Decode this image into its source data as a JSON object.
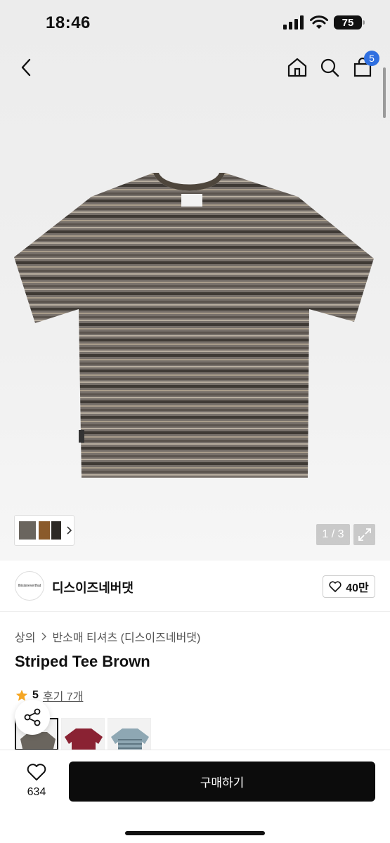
{
  "status_bar": {
    "time": "18:46",
    "battery": "75"
  },
  "nav": {
    "cart_count": "5"
  },
  "gallery": {
    "counter": "1 / 3"
  },
  "brand": {
    "name": "디스이즈네버댓",
    "logo_text": "thisisneverthat",
    "likes": "40만"
  },
  "breadcrumb": {
    "category": "상의",
    "subcategory": "반소매 티셔츠 (디스이즈네버댓)"
  },
  "product": {
    "title": "Striped Tee Brown"
  },
  "rating": {
    "score": "5",
    "reviews": "후기 7개"
  },
  "swatches": [
    {
      "color": "#6a655e",
      "selected": true
    },
    {
      "color": "#8a2233",
      "selected": false
    },
    {
      "color": "#8ea7b3",
      "selected": false
    }
  ],
  "bottom_bar": {
    "wish_count": "634",
    "buy_label": "구매하기"
  },
  "colors": {
    "accent": "#2f6fe0",
    "buy_button": "#0c0c0c"
  }
}
